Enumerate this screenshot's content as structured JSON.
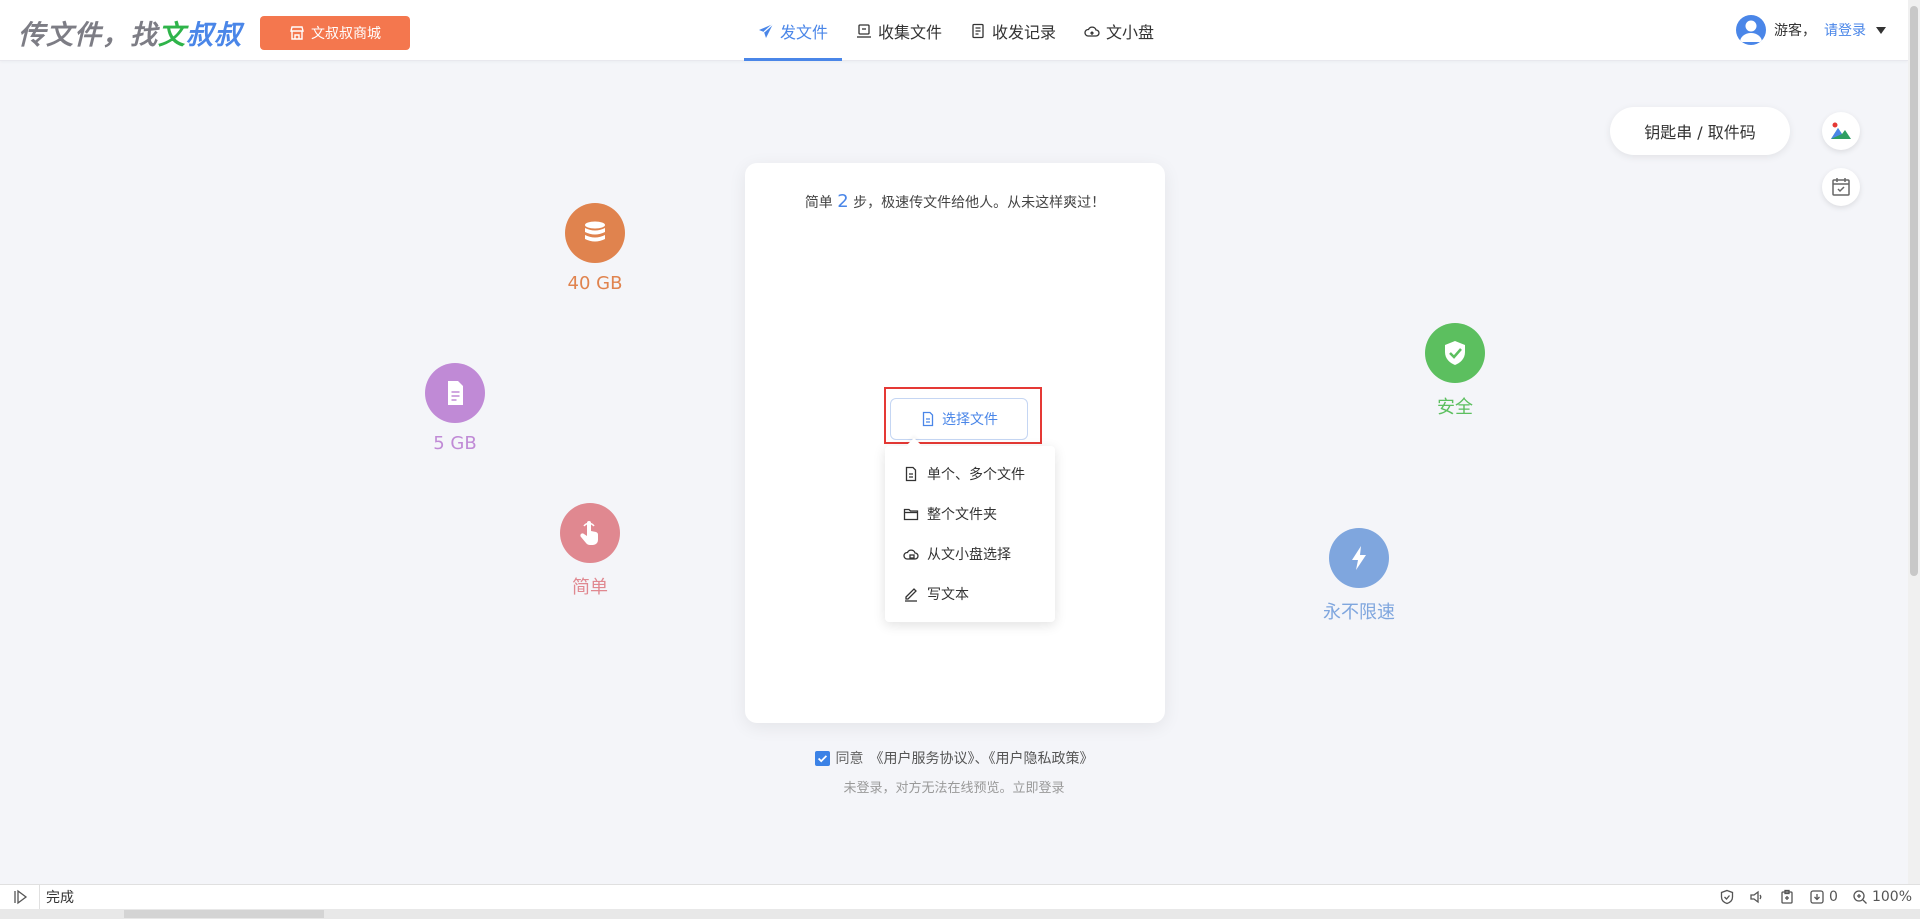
{
  "header": {
    "logo": {
      "prefix": "传文件，找",
      "highlight_green": "文",
      "highlight_blue": "叔叔"
    },
    "shop_button": "文叔叔商城",
    "nav": [
      {
        "label": "发文件",
        "icon": "send-icon",
        "active": true
      },
      {
        "label": "收集文件",
        "icon": "collect-icon",
        "active": false
      },
      {
        "label": "收发记录",
        "icon": "record-icon",
        "active": false
      },
      {
        "label": "文小盘",
        "icon": "cloud-disk-icon",
        "active": false
      }
    ],
    "user": {
      "guest": "游客，",
      "login": "请登录"
    }
  },
  "side": {
    "key_pill": "钥匙串 / 取件码"
  },
  "features": [
    {
      "label": "40 GB",
      "icon": "database-icon",
      "color": "#e0834e"
    },
    {
      "label": "5 GB",
      "icon": "document-icon",
      "color": "#c08ad6"
    },
    {
      "label": "简单",
      "icon": "hand-pointer-icon",
      "color": "#e08890"
    },
    {
      "label": "安全",
      "icon": "shield-check-icon",
      "color": "#5cbf5f"
    },
    {
      "label": "永不限速",
      "icon": "lightning-icon",
      "color": "#7fa6de"
    }
  ],
  "card": {
    "tagline_pre": "简单",
    "tagline_num": "2",
    "tagline_post": "步，极速传文件给他人。从未这样爽过！",
    "select_button": "选择文件",
    "dropdown": [
      {
        "label": "单个、多个文件",
        "icon": "file-icon"
      },
      {
        "label": "整个文件夹",
        "icon": "folder-icon"
      },
      {
        "label": "从文小盘选择",
        "icon": "cloud-disk-icon"
      },
      {
        "label": "写文本",
        "icon": "pen-icon"
      }
    ]
  },
  "agree": {
    "prefix": "同意",
    "links": "《用户服务协议》、《用户隐私政策》",
    "notice": "未登录，对方无法在线预览。立即登录"
  },
  "statusbar": {
    "status": "完成",
    "download_count": "0",
    "zoom": "100%"
  }
}
